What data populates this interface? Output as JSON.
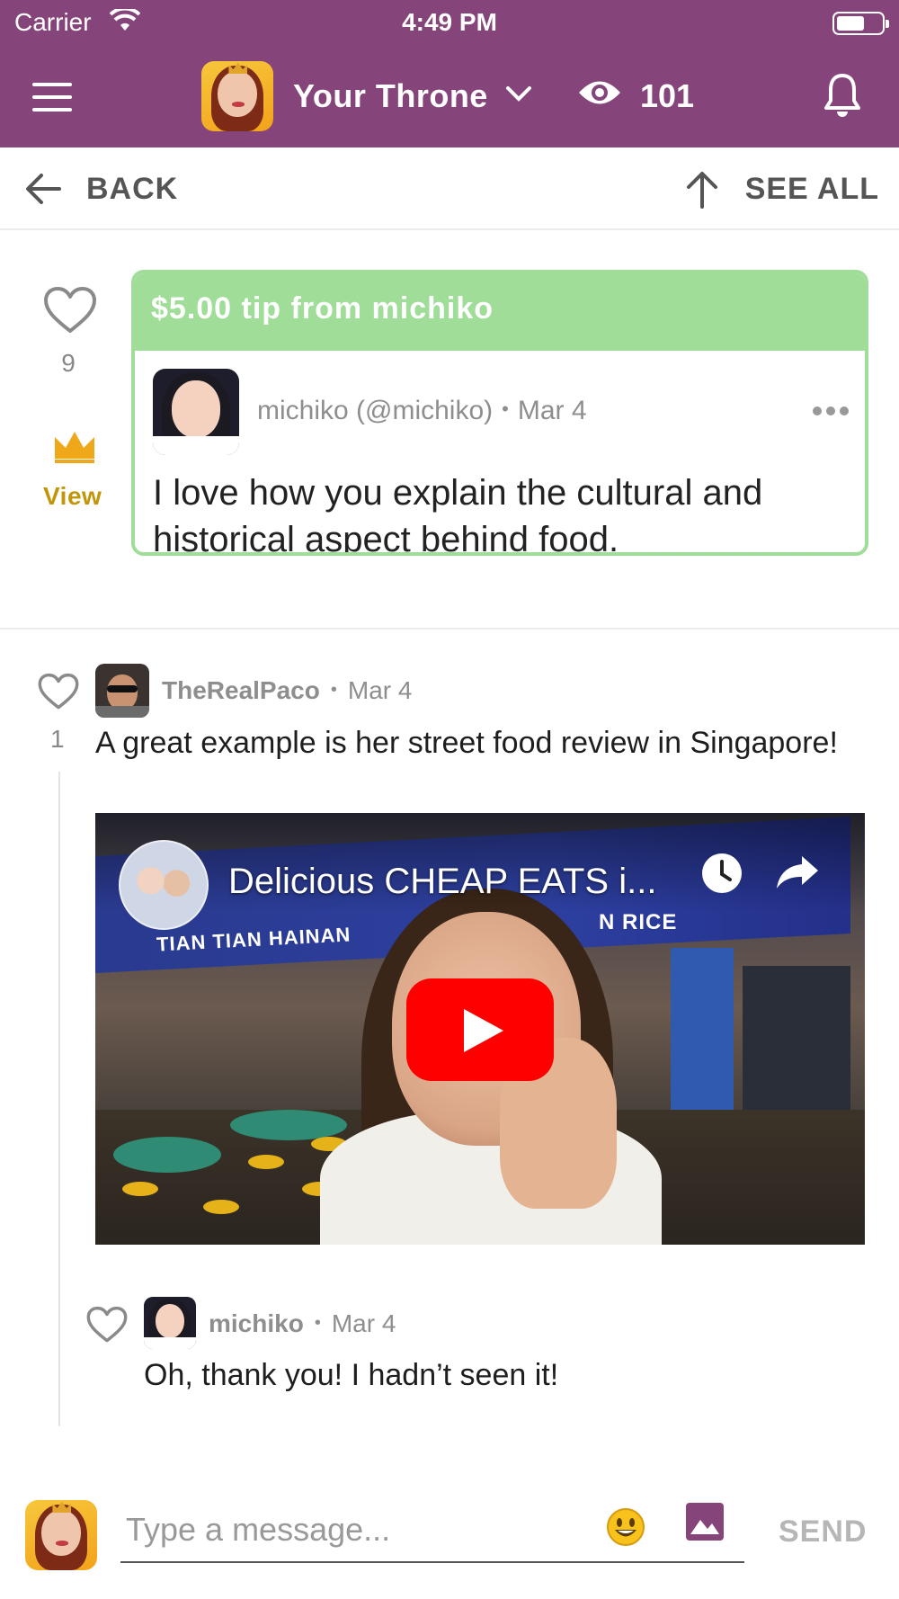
{
  "status_bar": {
    "carrier": "Carrier",
    "time": "4:49 PM"
  },
  "header": {
    "title": "Your Throne",
    "viewer_count": "101",
    "icons": [
      "menu-icon",
      "throne-avatar",
      "chevron-down-icon",
      "eye-icon",
      "bell-icon"
    ],
    "background": "#86457a"
  },
  "nav": {
    "back_label": "BACK",
    "see_all_label": "SEE ALL"
  },
  "tip": {
    "likes": "9",
    "view_label": "View",
    "header": "$5.00 tip from michiko",
    "author": "michiko (@michiko)",
    "date": "Mar 4",
    "message": "I love how you explain the cultural and historical aspect behind food.",
    "accent": "#9fdd99",
    "crown_color": "#f0a81b"
  },
  "comments": [
    {
      "author": "TheRealPaco",
      "date": "Mar 4",
      "likes": "1",
      "text": "A great example is her street food review in Singapore!",
      "video": {
        "title": "Delicious CHEAP EATS i...",
        "banner_left": "TIAN TIAN HAINAN",
        "banner_right": "N RICE"
      }
    },
    {
      "author": "michiko",
      "date": "Mar 4",
      "text": "Oh, thank you! I hadn’t seen it!"
    }
  ],
  "composer": {
    "placeholder": "Type a message...",
    "value": "",
    "send_label": "SEND",
    "icons": [
      "emoji-icon",
      "image-icon"
    ]
  }
}
